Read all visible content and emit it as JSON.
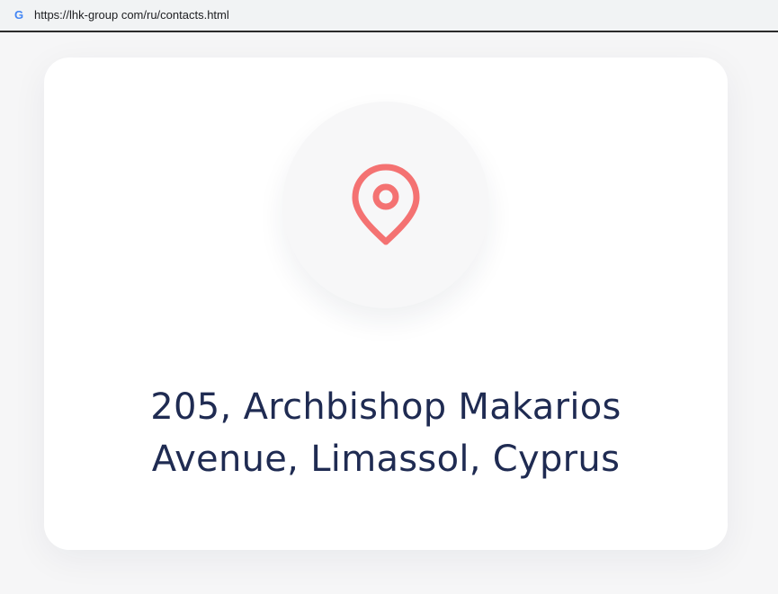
{
  "browser": {
    "url": "https://lhk-group com/ru/contacts.html",
    "favicon": "G",
    "favicon_icon": "google-g-icon"
  },
  "contact": {
    "icon": "map-pin-icon",
    "icon_color": "#f47272",
    "address_line1": "205, Archbishop Makarios",
    "address_line2": "Avenue, Limassol, Cyprus",
    "text_color": "#1f2b52"
  }
}
